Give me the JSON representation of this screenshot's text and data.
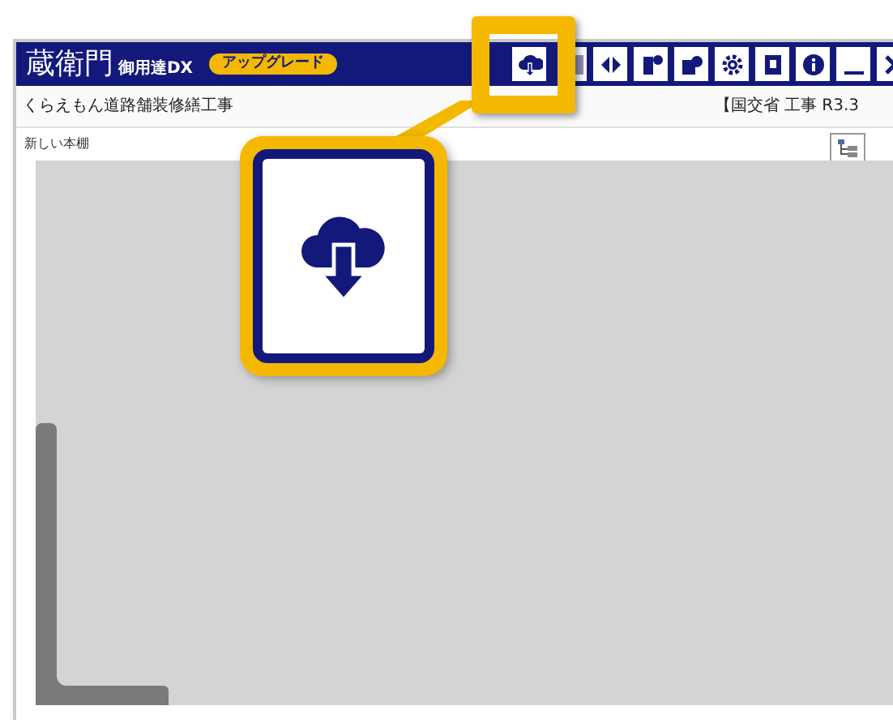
{
  "header": {
    "logo": "蔵衛門",
    "edition": "御用達DX",
    "upgrade_button": "アップグレード"
  },
  "project": {
    "name": "くらえもん道路舗装修繕工事",
    "info": "【国交省 工事 R3.3"
  },
  "shelf": {
    "label": "新しい本棚"
  }
}
